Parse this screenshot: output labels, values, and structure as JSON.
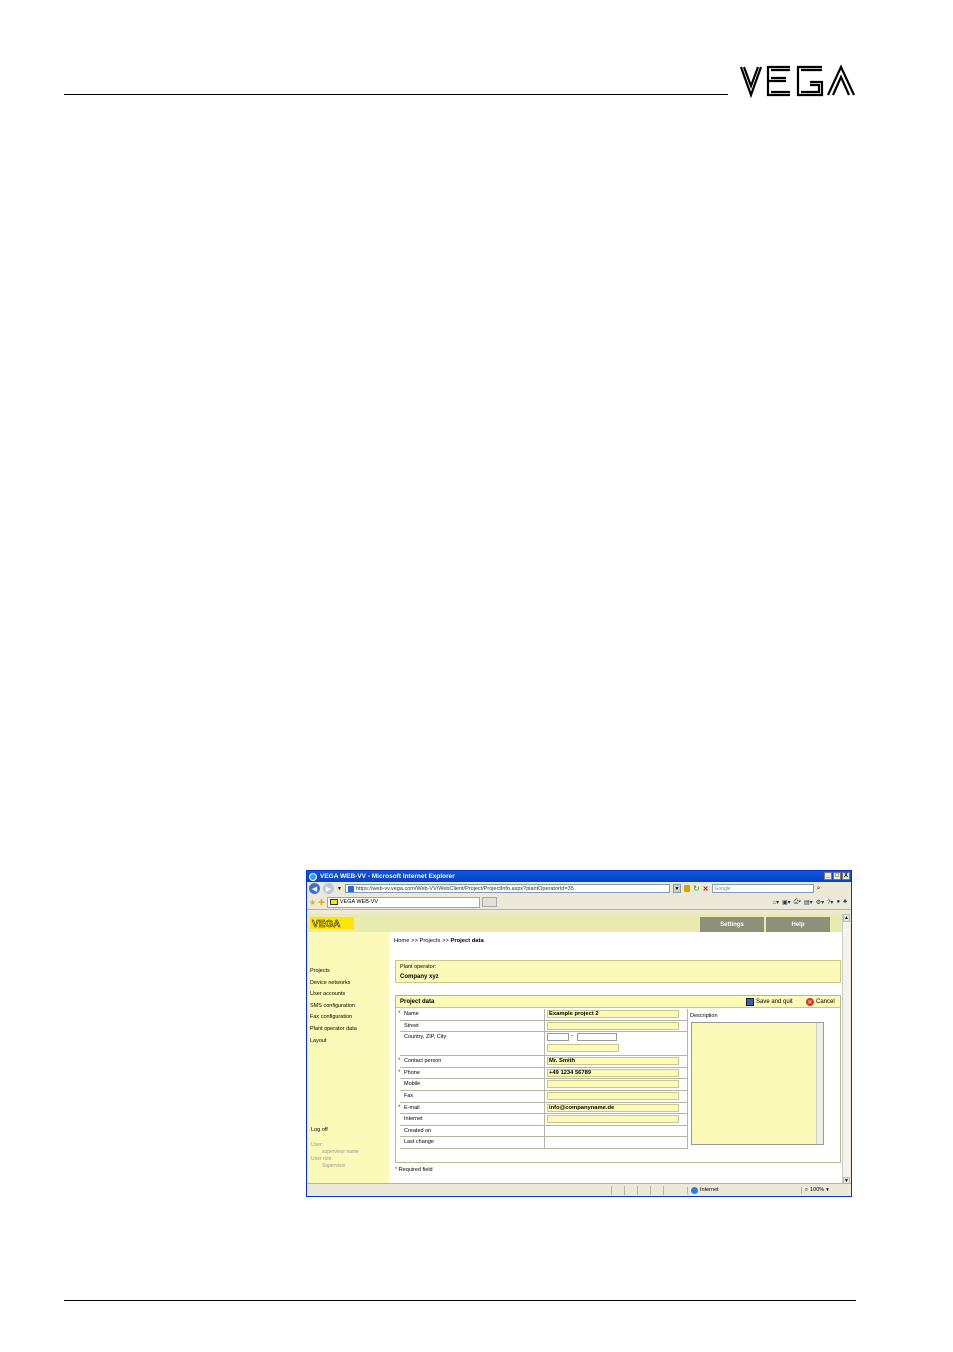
{
  "document": {
    "logo_text": "VEGA"
  },
  "browser": {
    "window_title": "VEGA WEB-VV - Microsoft Internet Explorer",
    "url": "https://web-vv.vega.com/Web-VV/WebClient/Project/ProjectInfo.aspx?plantOperatorId=35",
    "search_placeholder": "Google",
    "tab_title": "VEGA WEB-VV",
    "status_zone": "Internet",
    "zoom": "100%",
    "win_min": "_",
    "win_max": "□",
    "win_close": "X"
  },
  "app": {
    "logo_text": "VEGA",
    "menu": {
      "settings": "Settings",
      "help": "Help"
    },
    "sidebar": {
      "items": [
        "Projects",
        "Device networks",
        "User accounts",
        "SMS configuration",
        "Fax configuration",
        "Plant operator data",
        "Layout"
      ],
      "logoff": "Log off",
      "user_label": "User:",
      "user_value": "supervisor name",
      "role_label": "User role:",
      "role_value": "Supervisor"
    },
    "breadcrumb": {
      "home": "Home",
      "sep1": ">>",
      "projects": "Projects",
      "sep2": ">>",
      "current": "Project data"
    },
    "operator": {
      "label": "Plant operator:",
      "value": "Company xyz"
    },
    "project_panel": {
      "title": "Project data",
      "save_label": "Save and quit",
      "cancel_label": "Cancel",
      "description_label": "Description"
    },
    "form": {
      "name_label": "Name",
      "name_value": "Example project 2",
      "street_label": "Street",
      "street_value": "",
      "city_label": "Country, ZIP, City",
      "zip_separator": "-",
      "contact_label": "Contact person",
      "contact_value": "Mr. Smith",
      "phone_label": "Phone",
      "phone_value": "+49 1234 56789",
      "mobile_label": "Mobile",
      "mobile_value": "",
      "fax_label": "Fax",
      "fax_value": "",
      "email_label": "E-mail",
      "email_value": "info@companyname.de",
      "internet_label": "Internet",
      "internet_value": "",
      "created_label": "Created on",
      "changed_label": "Last change",
      "required_marker": "*"
    },
    "required_note": "Required field"
  }
}
